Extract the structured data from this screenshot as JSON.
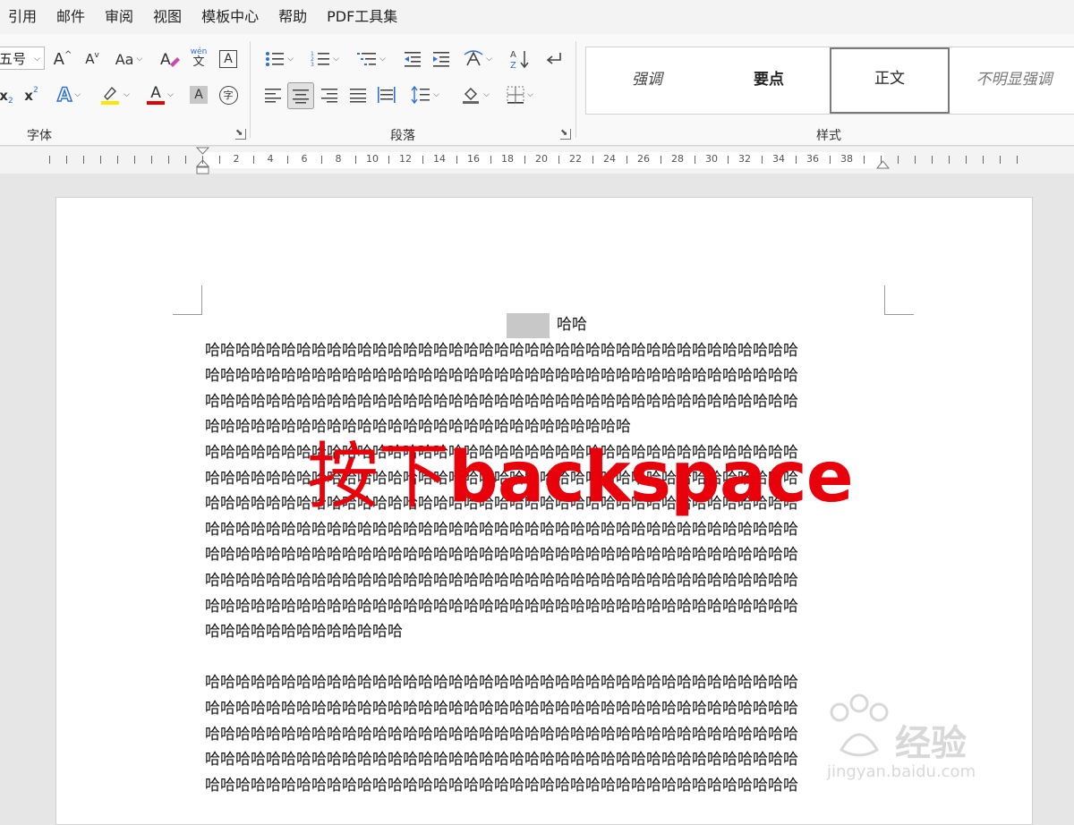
{
  "menu": [
    "引用",
    "邮件",
    "审阅",
    "视图",
    "模板中心",
    "帮助",
    "PDF工具集"
  ],
  "ribbon": {
    "font_group": {
      "label": "字体",
      "font_size": "五号",
      "grow_label": "A",
      "shrink_label": "A",
      "case_label": "Aa",
      "phonetic_label": "wén",
      "phonetic_char": "文",
      "border_char": "A",
      "sub_label": "x",
      "sup_label": "x",
      "text_effect": "A",
      "font_color": "A",
      "char_shading": "A",
      "enclose_char": "字"
    },
    "paragraph_group": {
      "label": "段落"
    },
    "styles_group": {
      "label": "样式",
      "items": [
        "强调",
        "要点",
        "正文",
        "不明显强调"
      ],
      "selected": "正文"
    }
  },
  "ruler": {
    "numbers": [
      "2",
      "4",
      "6",
      "8",
      "10",
      "12",
      "14",
      "16",
      "18",
      "20",
      "22",
      "24",
      "26",
      "28",
      "30",
      "32",
      "34",
      "36",
      "38"
    ]
  },
  "document": {
    "heading": "哈哈",
    "paragraph1": [
      "哈哈哈哈哈哈哈哈哈哈哈哈哈哈哈哈哈哈哈哈哈哈哈哈哈哈哈哈哈哈哈哈哈哈哈哈哈哈哈",
      "哈哈哈哈哈哈哈哈哈哈哈哈哈哈哈哈哈哈哈哈哈哈哈哈哈哈哈哈哈哈哈哈哈哈哈哈哈哈哈",
      "哈哈哈哈哈哈哈哈哈哈哈哈哈哈哈哈哈哈哈哈哈哈哈哈哈哈哈哈哈哈哈哈哈哈哈哈哈哈哈",
      "哈哈哈哈哈哈哈哈哈哈哈哈哈哈哈哈哈哈哈哈哈哈哈哈哈哈哈哈"
    ],
    "paragraph2": [
      "哈哈哈哈哈哈哈哈哈哈哈哈哈哈哈哈哈哈哈哈哈哈哈哈哈哈哈哈哈哈哈哈哈哈哈哈哈哈哈",
      "哈哈哈哈哈哈哈哈哈哈哈哈哈哈哈哈哈哈哈哈哈哈哈哈哈哈哈哈哈哈哈哈哈哈哈哈哈哈哈",
      "哈哈哈哈哈哈哈哈哈哈哈哈哈哈哈哈哈哈哈哈哈哈哈哈哈哈哈哈哈哈哈哈哈哈哈哈哈哈哈",
      "哈哈哈哈哈哈哈哈哈哈哈哈哈哈哈哈哈哈哈哈哈哈哈哈哈哈哈哈哈哈哈哈哈哈哈哈哈哈哈",
      "哈哈哈哈哈哈哈哈哈哈哈哈哈哈哈哈哈哈哈哈哈哈哈哈哈哈哈哈哈哈哈哈哈哈哈哈哈哈哈",
      "哈哈哈哈哈哈哈哈哈哈哈哈哈哈哈哈哈哈哈哈哈哈哈哈哈哈哈哈哈哈哈哈哈哈哈哈哈哈哈",
      "哈哈哈哈哈哈哈哈哈哈哈哈哈哈哈哈哈哈哈哈哈哈哈哈哈哈哈哈哈哈哈哈哈哈哈哈哈哈哈",
      "哈哈哈哈哈哈哈哈哈哈哈哈哈"
    ],
    "paragraph3": [
      "哈哈哈哈哈哈哈哈哈哈哈哈哈哈哈哈哈哈哈哈哈哈哈哈哈哈哈哈哈哈哈哈哈哈哈哈哈哈哈",
      "哈哈哈哈哈哈哈哈哈哈哈哈哈哈哈哈哈哈哈哈哈哈哈哈哈哈哈哈哈哈哈哈哈哈哈哈哈哈哈",
      "哈哈哈哈哈哈哈哈哈哈哈哈哈哈哈哈哈哈哈哈哈哈哈哈哈哈哈哈哈哈哈哈哈哈哈哈哈哈哈",
      "哈哈哈哈哈哈哈哈哈哈哈哈哈哈哈哈哈哈哈哈哈哈哈哈哈哈哈哈哈哈哈哈哈哈哈哈哈哈哈",
      "哈哈哈哈哈哈哈哈哈哈哈哈哈哈哈哈哈哈哈哈哈哈哈哈哈哈哈哈哈哈哈哈哈哈哈哈哈哈哈"
    ]
  },
  "overlay": {
    "cjk": "按下",
    "latin": "backspace"
  },
  "watermark": {
    "brand": "经验",
    "sub": "jingyan.baidu.com"
  },
  "colors": {
    "overlay_red": "#e8000b",
    "highlight_yellow": "#ffe600",
    "font_red": "#e00000",
    "text_effect_blue": "#2f6fd6"
  }
}
